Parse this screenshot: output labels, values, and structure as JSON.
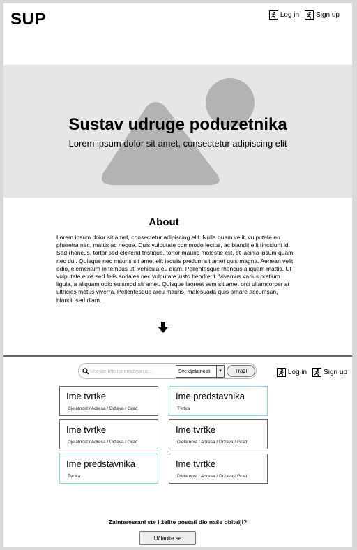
{
  "header": {
    "logo": "SUP",
    "login_label": "Log in",
    "signup_label": "Sign up"
  },
  "hero": {
    "title": "Sustav udruge poduzetnika",
    "subtitle": "Lorem ipsum dolor sit amet, consectetur adipiscing elit",
    "image_icon": "image-placeholder-icon"
  },
  "about": {
    "title": "About",
    "text": "Lorem ipsum dolor sit amet, consectetur adipiscing elit. Nulla quam velit, vulputate eu pharetra nec, mattis ac neque. Duis vulputate commodo lectus, ac blandit elit tincidunt id. Sed rhoncus, tortor sed eleifend tristique, tortor mauris molestie elit, et lacinia ipsum quam nec dui. Quisque nec mauris sit amet elit iaculis pretium sit amet quis magna. Aenean velit odio, elementum in tempus ut, vehicula eu diam. Pellentesque rhoncus aliquam mattis. Ut vulputate eros sed felis sodales nec vulputate justo hendrerit. Vivamus varius pretium ligula, a aliquam odio euismod sit amet. Quisque laoreet sem sit amet orci ullamcorper at ultricies metus viverra. Pellentesque arcu mauris, malesuada quis ornare accumsan, blandit sed diam.",
    "scroll_icon": "arrow-down-icon"
  },
  "search": {
    "placeholder": "Unesite tekst pretraživanja...",
    "filter_selected": "Sve djelatnosti",
    "button_label": "Traži"
  },
  "cards": [
    {
      "title": "Ime tvrtke",
      "subtitle": "Djelatnost / Adresa / Država / Grad"
    },
    {
      "title": "Ime predstavnika",
      "subtitle": "Tvrtka"
    },
    {
      "title": "Ime tvrtke",
      "subtitle": "Djelatnost / Adresa / Država / Grad"
    },
    {
      "title": "Ime tvrtke",
      "subtitle": "Djelatnost / Adresa / Država / Grad"
    },
    {
      "title": "Ime predstavnika",
      "subtitle": "Tvrtka"
    },
    {
      "title": "Ime tvrtke",
      "subtitle": "Djelatnost / Adresa / Država / Grad"
    }
  ],
  "cta": {
    "text": "Zainteresrani ste i želite postati dio naše obitelji?",
    "button_label": "Učlanite se"
  },
  "colors": {
    "hero_background": "#e6e6e6",
    "placeholder_shape": "#b3b3b3",
    "representative_card_border": "#7fd8e6"
  }
}
